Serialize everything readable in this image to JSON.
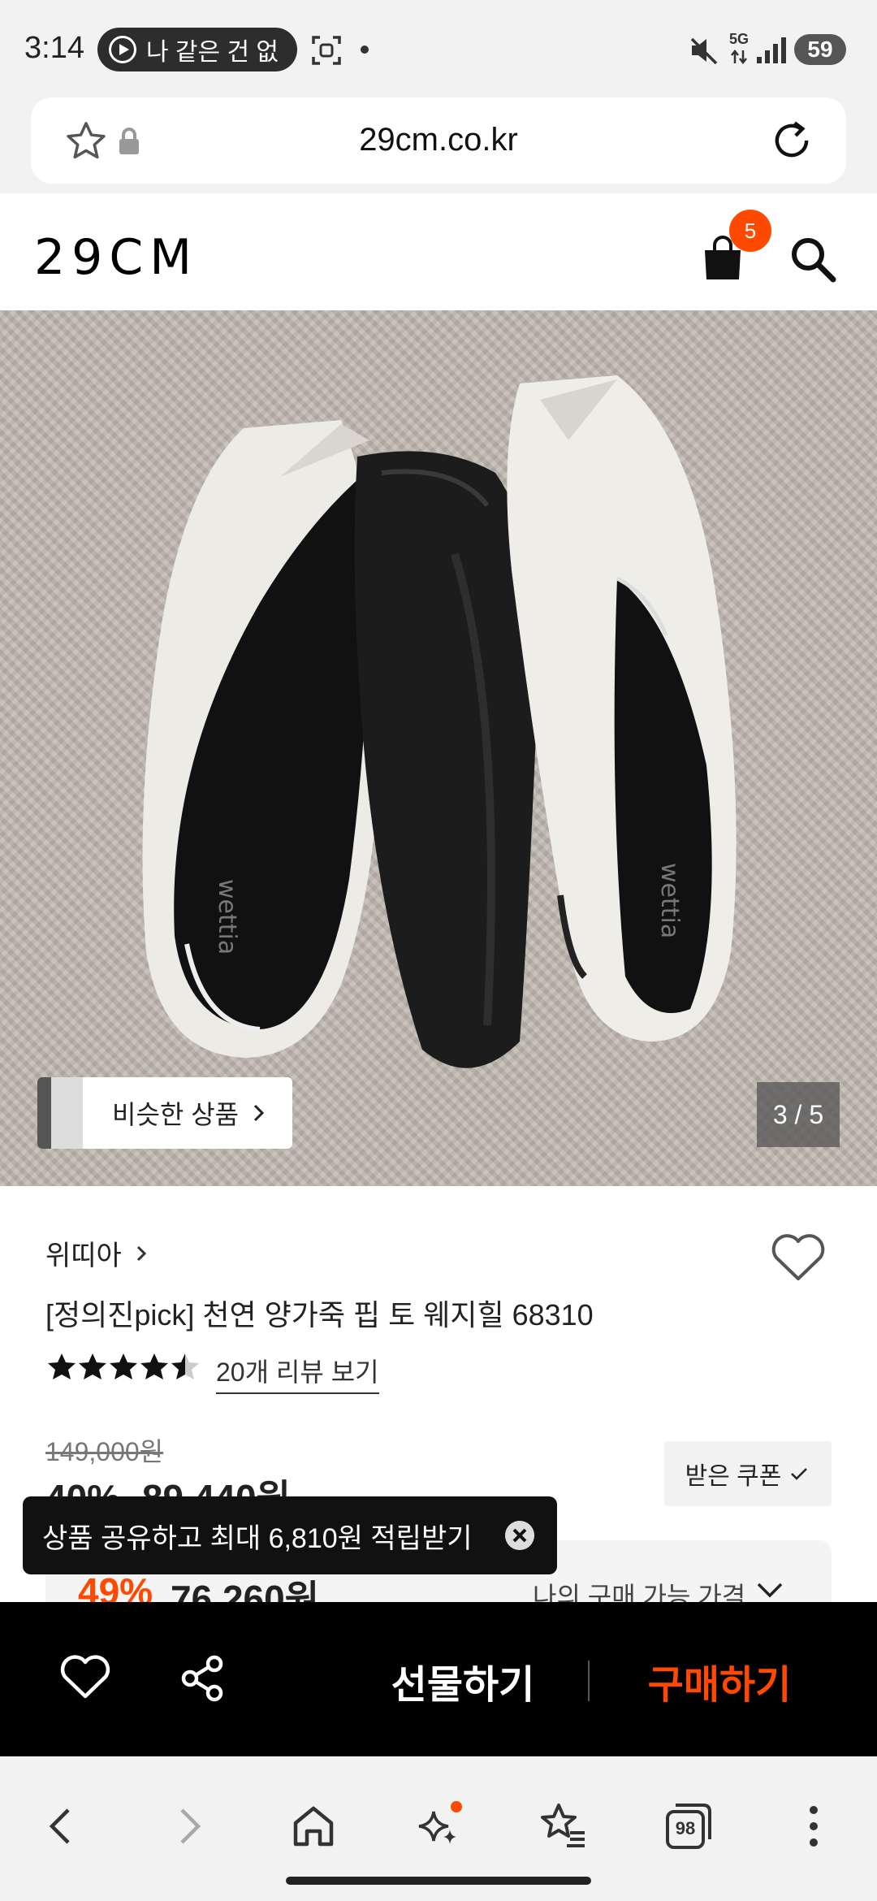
{
  "status_bar": {
    "time": "3:14",
    "media_text": "나 같은 건 없",
    "network": "5G",
    "battery": "59"
  },
  "browser": {
    "url": "29cm.co.kr"
  },
  "site": {
    "logo": "29CM",
    "cart_count": "5"
  },
  "gallery": {
    "similar_label": "비슷한 상품",
    "counter": "3 / 5"
  },
  "product": {
    "brand": "위띠아",
    "title": "[정의진pick] 천연 양가죽 핍 토 웨지힐 68310",
    "rating": 4.5,
    "review_link": "20개 리뷰 보기",
    "original_price": "149,000원",
    "discount_pct": "40%",
    "sale_price": "89,440원",
    "coupon_label": "받은 쿠폰",
    "best_pct": "49%",
    "best_price": "76,260원",
    "best_label": "나의 구매 가능 가격"
  },
  "toast": {
    "message": "상품 공유하고 최대 6,810원 적립받기"
  },
  "action_bar": {
    "gift_label": "선물하기",
    "buy_label": "구매하기"
  },
  "nav_bar": {
    "tabs_count": "98"
  },
  "colors": {
    "accent": "#ff4800",
    "action_bar_bg": "#000000",
    "chrome_bg": "#f2f2f2"
  }
}
